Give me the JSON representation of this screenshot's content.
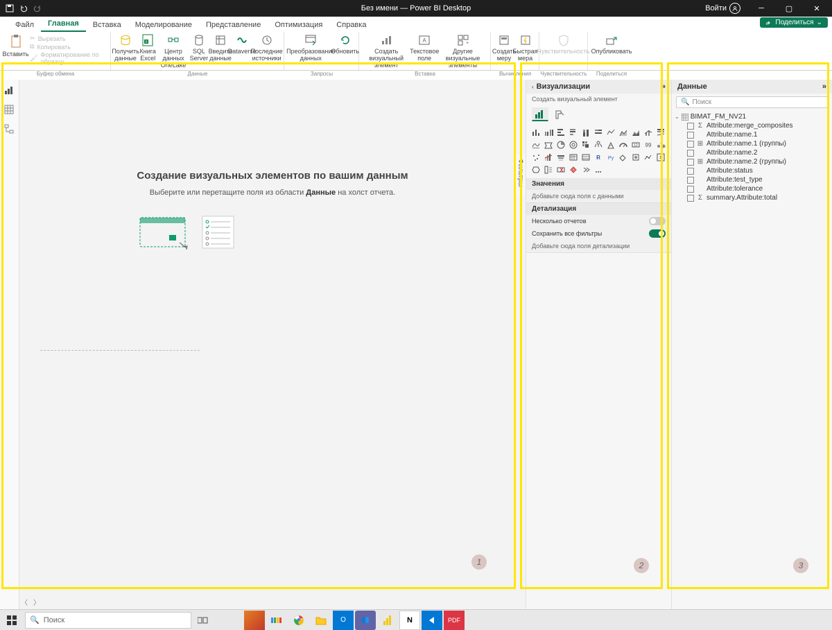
{
  "title": "Без имени — Power BI Desktop",
  "signin": "Войти",
  "menu": {
    "file": "Файл",
    "home": "Главная",
    "insert": "Вставка",
    "model": "Моделирование",
    "view": "Представление",
    "optim": "Оптимизация",
    "help": "Справка"
  },
  "share": "Поделиться",
  "ribbon": {
    "clipboard": {
      "paste": "Вставить",
      "cut": "Вырезать",
      "copy": "Копировать",
      "format": "Форматирование по образцу",
      "group": "Буфер обмена"
    },
    "data": {
      "get": "Получить данные",
      "excel": "Книга Excel",
      "hub": "Центр данных OneLake",
      "sql": "SQL Server",
      "enter": "Введите данные",
      "dataverse": "Dataverse",
      "recent": "Последние источники",
      "group": "Данные"
    },
    "queries": {
      "transform": "Преобразование данных",
      "refresh": "Обновить",
      "group": "Запросы"
    },
    "insert": {
      "newviz": "Создать визуальный элемент",
      "textbox": "Текстовое поле",
      "other": "Другие визуальные элементы",
      "group": "Вставка"
    },
    "calc": {
      "newmeasure": "Создать меру",
      "quick": "Быстрая мера",
      "group": "Вычисления"
    },
    "sens": {
      "label": "Чувствительность",
      "group": "Чувствительность"
    },
    "publish": {
      "label": "Опубликовать",
      "group": "Поделиться"
    }
  },
  "canvas": {
    "title": "Создание визуальных элементов по вашим данным",
    "sub1": "Выберите или перетащите поля из области ",
    "sub_bold": "Данные",
    "sub2": " на холст отчета."
  },
  "viz": {
    "header": "Визуализации",
    "sub": "Создать визуальный элемент",
    "values": "Значения",
    "values_drop": "Добавьте сюда поля с данными",
    "drill": "Детализация",
    "cross": "Несколько отчетов",
    "keep": "Сохранить все фильтры",
    "drill_drop": "Добавьте сюда поля детализации"
  },
  "filters_tab": "Фильтры",
  "datapane": {
    "header": "Данные",
    "search": "Поиск",
    "table": "BIMAT_FM_NV21",
    "fields": [
      {
        "icon": "Σ",
        "label": "Attribute:merge_composites"
      },
      {
        "icon": "",
        "label": "Attribute:name.1"
      },
      {
        "icon": "⊞",
        "label": "Attribute:name.1 (группы)"
      },
      {
        "icon": "",
        "label": "Attribute:name.2"
      },
      {
        "icon": "⊞",
        "label": "Attribute:name.2 (группы)"
      },
      {
        "icon": "",
        "label": "Attribute:status"
      },
      {
        "icon": "",
        "label": "Attribute:test_type"
      },
      {
        "icon": "",
        "label": "Attribute:tolerance"
      },
      {
        "icon": "Σ",
        "label": "summary.Attribute:total"
      }
    ]
  },
  "taskbar": {
    "search": "Поиск"
  },
  "badges": {
    "b1": "1",
    "b2": "2",
    "b3": "3"
  }
}
